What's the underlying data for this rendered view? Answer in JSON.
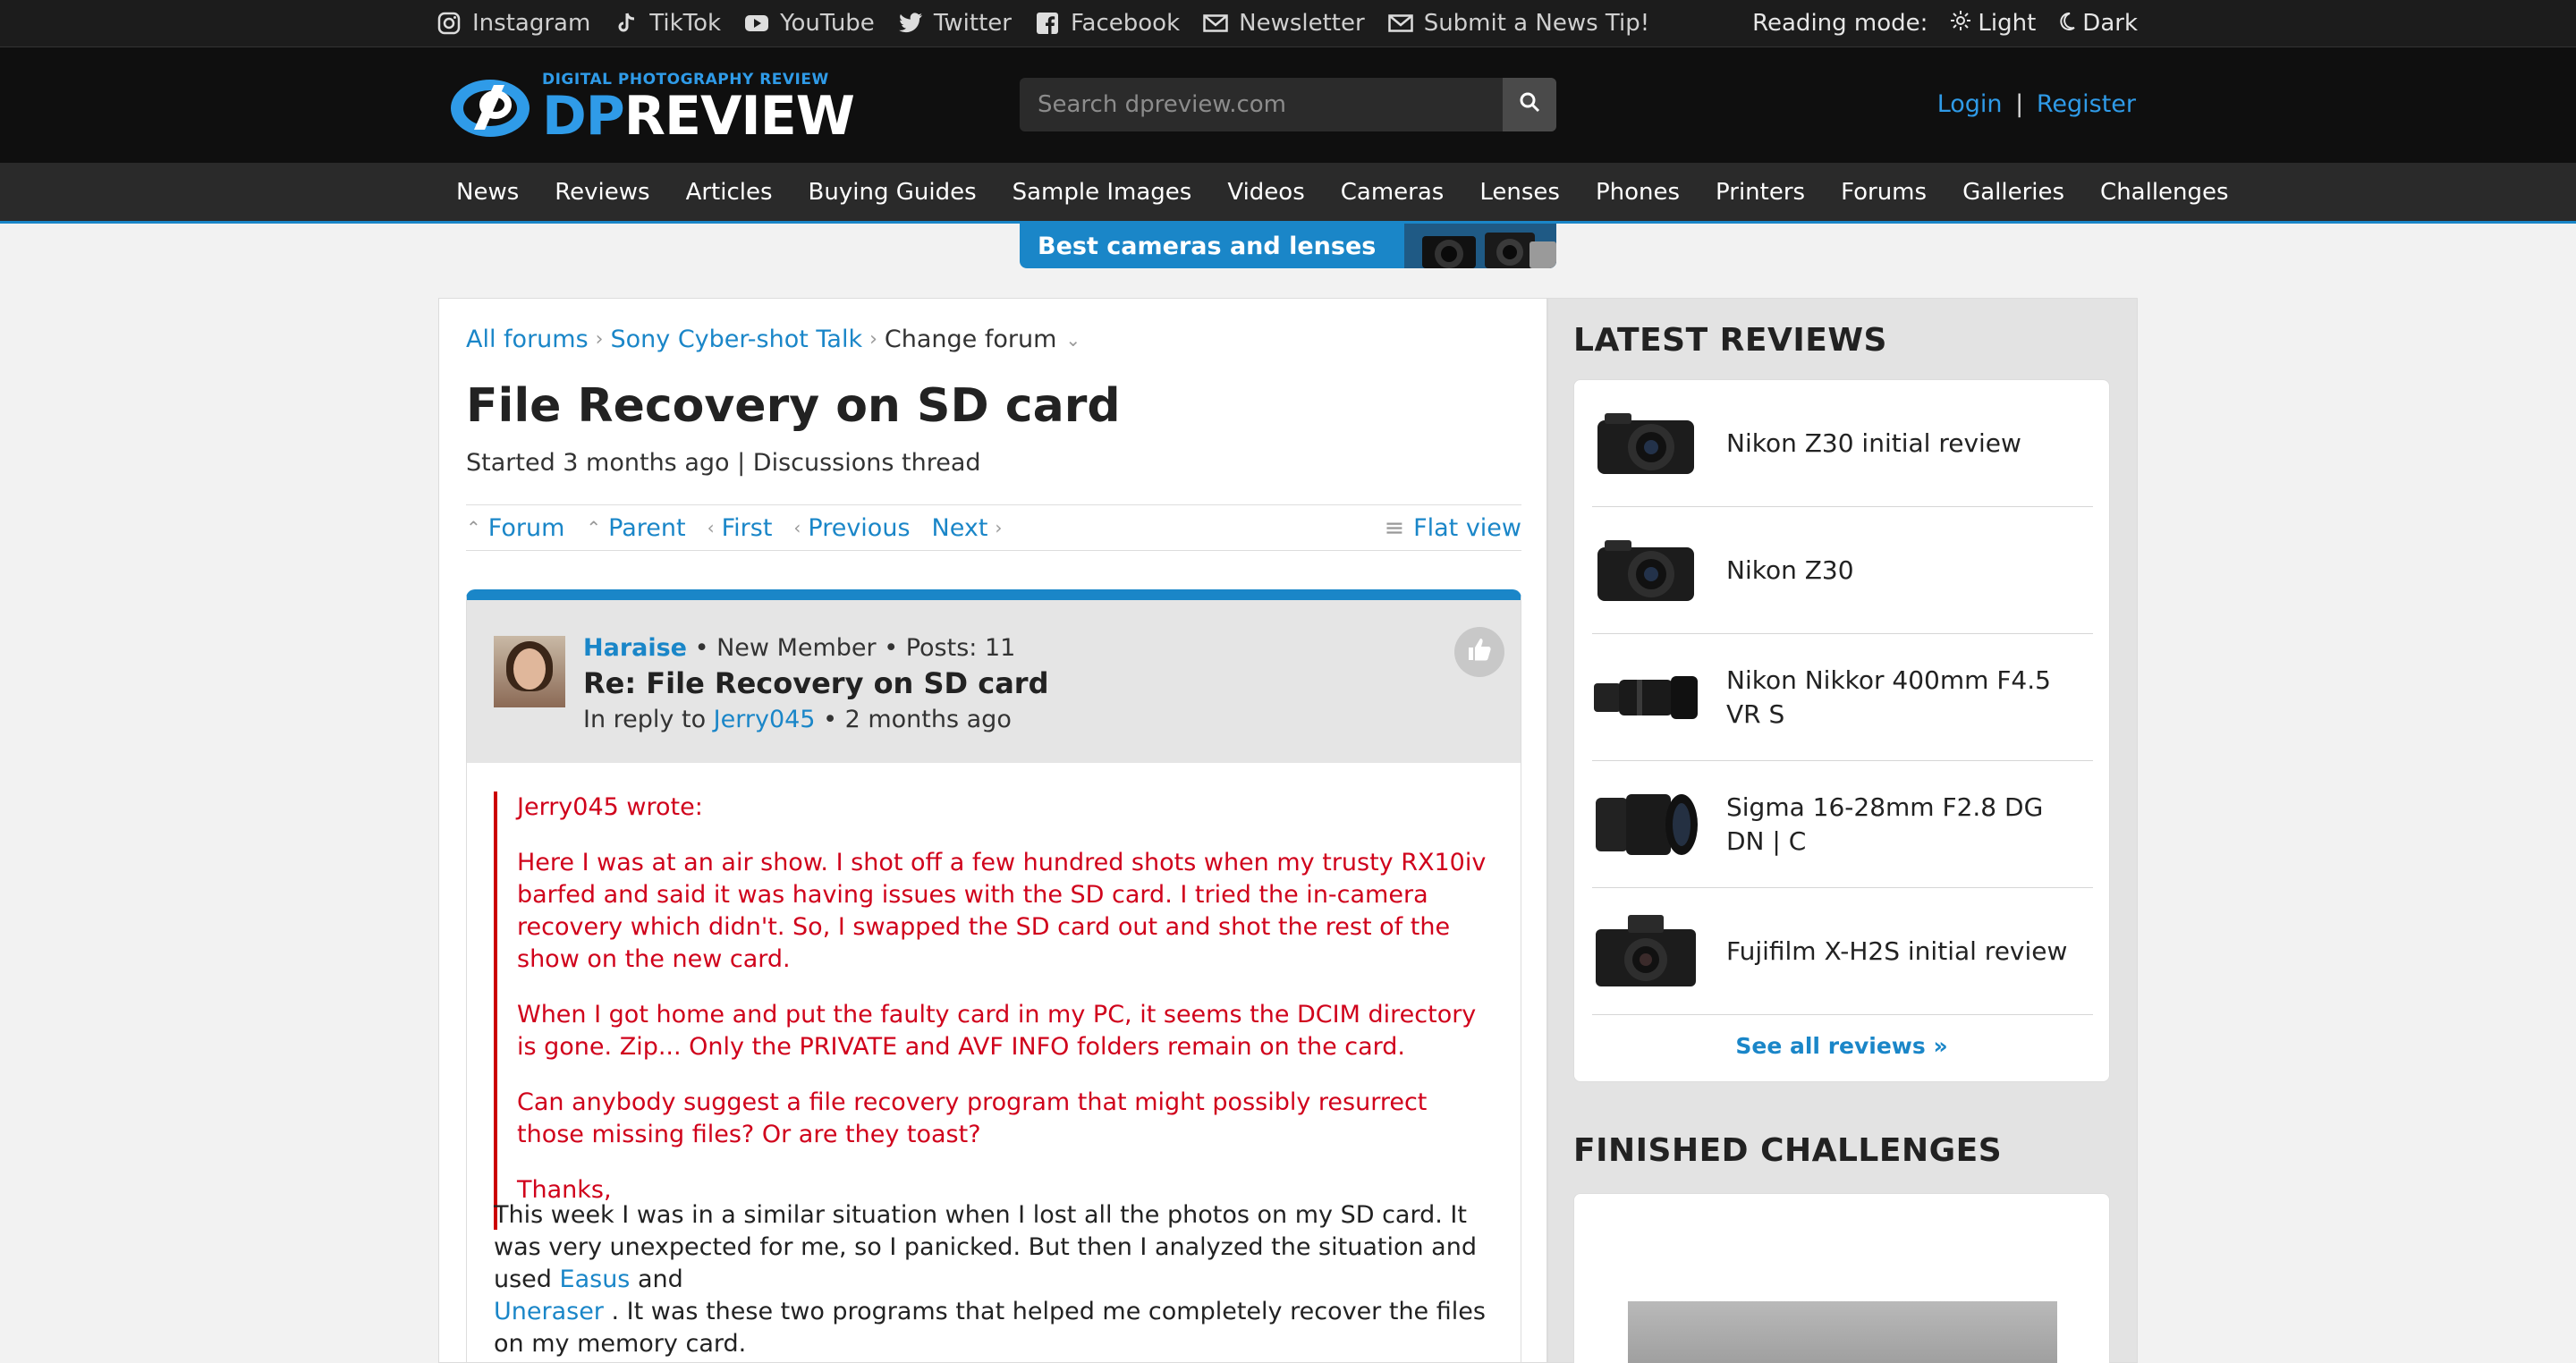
{
  "social": {
    "links": [
      {
        "icon": "instagram-icon",
        "label": "Instagram"
      },
      {
        "icon": "tiktok-icon",
        "label": "TikTok"
      },
      {
        "icon": "youtube-icon",
        "label": "YouTube"
      },
      {
        "icon": "twitter-icon",
        "label": "Twitter"
      },
      {
        "icon": "facebook-icon",
        "label": "Facebook"
      },
      {
        "icon": "mail-icon",
        "label": "Newsletter"
      },
      {
        "icon": "mail-icon",
        "label": "Submit a News Tip!"
      }
    ],
    "reading_mode_label": "Reading mode:",
    "light_label": "Light",
    "dark_label": "Dark"
  },
  "header": {
    "logo_tagline": "DIGITAL PHOTOGRAPHY REVIEW",
    "logo_dp": "DP",
    "logo_review": "REVIEW",
    "search_placeholder": "Search dpreview.com",
    "login_label": "Login",
    "register_label": "Register",
    "auth_sep": "|"
  },
  "nav": [
    "News",
    "Reviews",
    "Articles",
    "Buying Guides",
    "Sample Images",
    "Videos",
    "Cameras",
    "Lenses",
    "Phones",
    "Printers",
    "Forums",
    "Galleries",
    "Challenges"
  ],
  "promo": {
    "label": "Best cameras and lenses"
  },
  "breadcrumb": {
    "all_forums": "All forums",
    "forum": "Sony Cyber-shot Talk",
    "change": "Change forum"
  },
  "thread": {
    "title": "File Recovery on SD card",
    "meta": "Started 3 months ago | Discussions thread",
    "nav": {
      "forum": "Forum",
      "parent": "Parent",
      "first": "First",
      "previous": "Previous",
      "next": "Next",
      "flat": "Flat view"
    }
  },
  "post": {
    "author": "Haraise",
    "author_meta": " • New Member • Posts: 11",
    "title": "Re: File Recovery on SD card",
    "reply_prefix": "In reply to ",
    "reply_to": "Jerry045",
    "reply_time": " • 2 months ago",
    "quote": {
      "header": "Jerry045 wrote:",
      "p1": "Here I was at an air show. I shot off a few hundred shots when my trusty RX10iv barfed and said it was having issues with the SD card. I tried the in-camera recovery which didn't. So, I swapped the SD card out and shot the rest of the show on the new card.",
      "p2": "When I got home and put the faulty card in my PC, it seems the DCIM directory is gone. Zip... Only the PRIVATE and AVF INFO folders remain on the card.",
      "p3": "Can anybody suggest a file recovery program that might possibly resurrect those missing files? Or are they toast?",
      "p4": "Thanks,"
    },
    "body_a": "This week I was in a similar situation when I lost all the photos on my SD card. It was very unexpected for me, so I panicked. But then I analyzed the situation and used ",
    "link1": "Easus",
    "body_b": " and ",
    "link2": "Uneraser",
    "body_c": " . It was these two programs that helped me completely recover the files on my memory card."
  },
  "sidebar": {
    "latest_reviews_title": "LATEST REVIEWS",
    "reviews": [
      {
        "name": "Nikon Z30 initial review"
      },
      {
        "name": "Nikon Z30"
      },
      {
        "name": "Nikon Nikkor 400mm F4.5 VR S"
      },
      {
        "name": "Sigma 16-28mm F2.8 DG DN | C"
      },
      {
        "name": "Fujifilm X-H2S initial review"
      }
    ],
    "see_all": "See all reviews »",
    "finished_challenges_title": "FINISHED CHALLENGES"
  }
}
